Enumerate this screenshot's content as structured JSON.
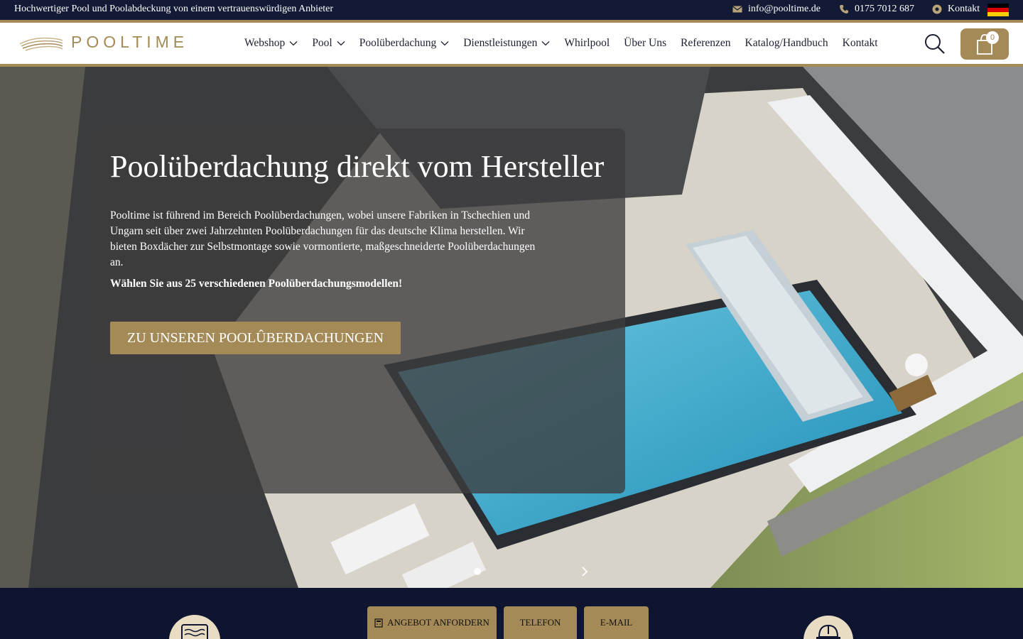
{
  "topbar": {
    "tagline": "Hochwertiger Pool und Poolabdeckung von einem vertrauenswürdigen Anbieter",
    "email": "info@pooltime.de",
    "phone": "0175 7012 687",
    "contact": "Kontakt",
    "email_icon": "envelope-icon",
    "phone_icon": "phone-icon",
    "contact_icon": "location-pin-icon",
    "flag_icon": "germany-flag-icon"
  },
  "header": {
    "logo_text": "POOLTIME",
    "nav": [
      {
        "label": "Webshop",
        "dropdown": true
      },
      {
        "label": "Pool",
        "dropdown": true
      },
      {
        "label": "Poolüberdachung",
        "dropdown": true
      },
      {
        "label": "Dienstleistungen",
        "dropdown": true
      },
      {
        "label": "Whirlpool",
        "dropdown": false
      },
      {
        "label": "Über Uns",
        "dropdown": false
      },
      {
        "label": "Referenzen",
        "dropdown": false
      },
      {
        "label": "Katalog/Handbuch",
        "dropdown": false
      },
      {
        "label": "Kontakt",
        "dropdown": false
      }
    ],
    "cart_count": "0",
    "search_icon": "search-icon",
    "cart_icon": "shopping-bag-icon"
  },
  "hero": {
    "title": "Poolüberdachung direkt vom Hersteller",
    "text": "Pooltime ist führend im Bereich Poolüberdachungen, wobei unsere Fabriken in Tschechien und Ungarn seit über zwei Jahrzehnten Poolüberdachungen für das deutsche Klima herstellen. Wir bieten Boxdächer zur Selbstmontage sowie vormontierte, maßgeschneiderte Poolüberdachungen an.",
    "bold_text": "Wählen Sie aus 25 verschiedenen Poolüberdachungsmodellen!",
    "cta": "ZU UNSEREN POOLÛBERDACHUNGEN"
  },
  "band": {
    "buttons": [
      {
        "label": "ANGEBOT ANFORDERN",
        "icon": "calculator-icon"
      },
      {
        "label": "TELEFON",
        "icon": ""
      },
      {
        "label": "E-MAIL",
        "icon": ""
      }
    ],
    "left_icon": "pool-icon",
    "right_icon": "hard-hat-icon"
  },
  "colors": {
    "accent": "#a48a57",
    "dark": "#131a35",
    "band": "#0f1530"
  }
}
